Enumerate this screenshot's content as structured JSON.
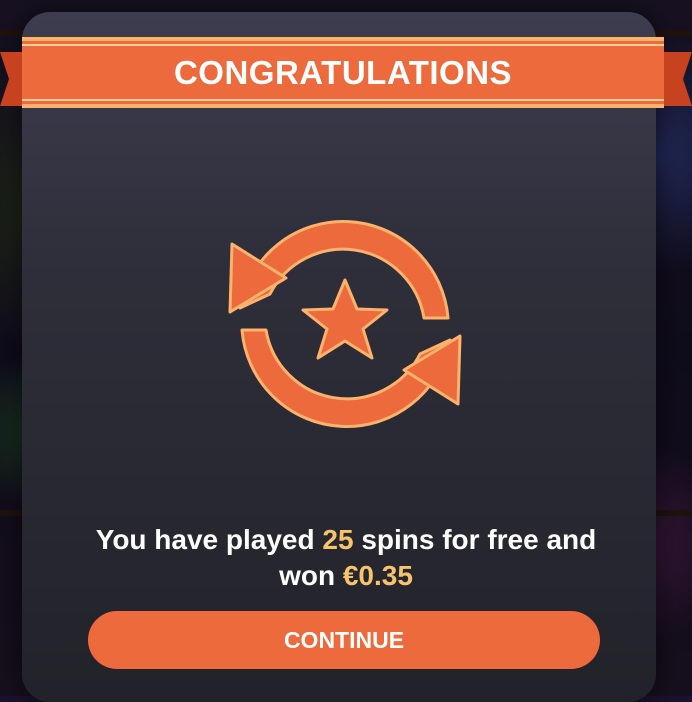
{
  "modal": {
    "title": "CONGRATULATIONS",
    "message": {
      "line1_prefix": "You have played ",
      "spins": "25",
      "line1_suffix": " spins for free and",
      "line2_prefix": "won ",
      "amount": "€0.35"
    },
    "continue_label": "CONTINUE",
    "icon": "free-spins-icon"
  },
  "colors": {
    "accent": "#ec6a3c",
    "accent_outline": "#ffb26c",
    "highlight_text": "#f7c46c",
    "panel_top": "#3e3d4f",
    "panel_bottom": "#222229"
  }
}
